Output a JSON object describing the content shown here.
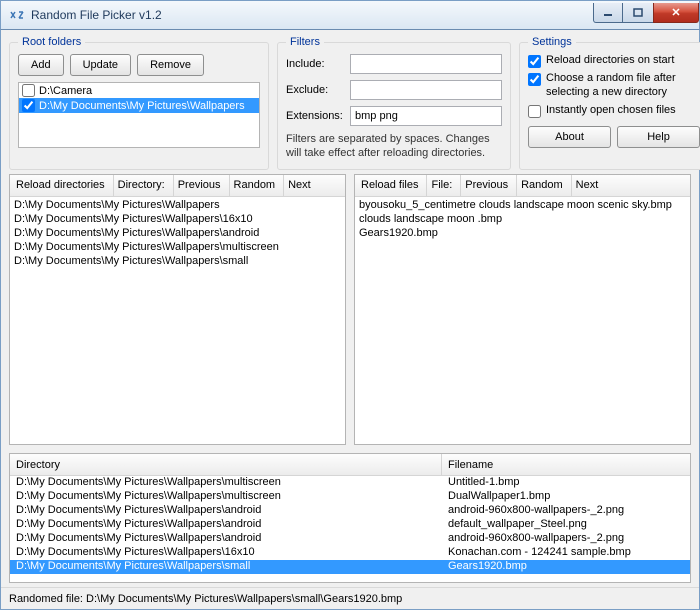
{
  "window": {
    "title": "Random File Picker v1.2"
  },
  "rootFolders": {
    "legend": "Root folders",
    "btnAdd": "Add",
    "btnUpdate": "Update",
    "btnRemove": "Remove",
    "items": [
      {
        "checked": false,
        "label": "D:\\Camera"
      },
      {
        "checked": true,
        "label": "D:\\My Documents\\My Pictures\\Wallpapers"
      }
    ]
  },
  "filters": {
    "legend": "Filters",
    "includeLabel": "Include:",
    "includeValue": "",
    "excludeLabel": "Exclude:",
    "excludeValue": "",
    "extLabel": "Extensions:",
    "extValue": "bmp png",
    "note": "Filters are separated by spaces. Changes will take effect after reloading directories."
  },
  "settings": {
    "legend": "Settings",
    "opt1": "Reload directories on start",
    "opt2": "Choose a random file after selecting a new directory",
    "opt3": "Instantly open chosen files",
    "btnAbout": "About",
    "btnHelp": "Help"
  },
  "dirPanel": {
    "reload": "Reload directories",
    "dirLabel": "Directory:",
    "prev": "Previous",
    "random": "Random",
    "next": "Next",
    "items": [
      "D:\\My Documents\\My Pictures\\Wallpapers",
      "D:\\My Documents\\My Pictures\\Wallpapers\\16x10",
      "D:\\My Documents\\My Pictures\\Wallpapers\\android",
      "D:\\My Documents\\My Pictures\\Wallpapers\\multiscreen",
      "D:\\My Documents\\My Pictures\\Wallpapers\\small"
    ]
  },
  "filePanel": {
    "reload": "Reload files",
    "fileLabel": "File:",
    "prev": "Previous",
    "random": "Random",
    "next": "Next",
    "items": [
      "byousoku_5_centimetre clouds landscape moon scenic sky.bmp",
      "clouds landscape moon .bmp",
      "Gears1920.bmp"
    ]
  },
  "table": {
    "colDir": "Directory",
    "colFile": "Filename",
    "rows": [
      {
        "dir": "D:\\My Documents\\My Pictures\\Wallpapers\\multiscreen",
        "file": "Untitled-1.bmp"
      },
      {
        "dir": "D:\\My Documents\\My Pictures\\Wallpapers\\multiscreen",
        "file": "DualWallpaper1.bmp"
      },
      {
        "dir": "D:\\My Documents\\My Pictures\\Wallpapers\\android",
        "file": "android-960x800-wallpapers-_2.png"
      },
      {
        "dir": "D:\\My Documents\\My Pictures\\Wallpapers\\android",
        "file": "default_wallpaper_Steel.png"
      },
      {
        "dir": "D:\\My Documents\\My Pictures\\Wallpapers\\android",
        "file": "android-960x800-wallpapers-_2.png"
      },
      {
        "dir": "D:\\My Documents\\My Pictures\\Wallpapers\\16x10",
        "file": "Konachan.com - 124241 sample.bmp"
      },
      {
        "dir": "D:\\My Documents\\My Pictures\\Wallpapers\\small",
        "file": "Gears1920.bmp"
      }
    ],
    "selectedIndex": 6
  },
  "status": "Randomed file: D:\\My Documents\\My Pictures\\Wallpapers\\small\\Gears1920.bmp"
}
